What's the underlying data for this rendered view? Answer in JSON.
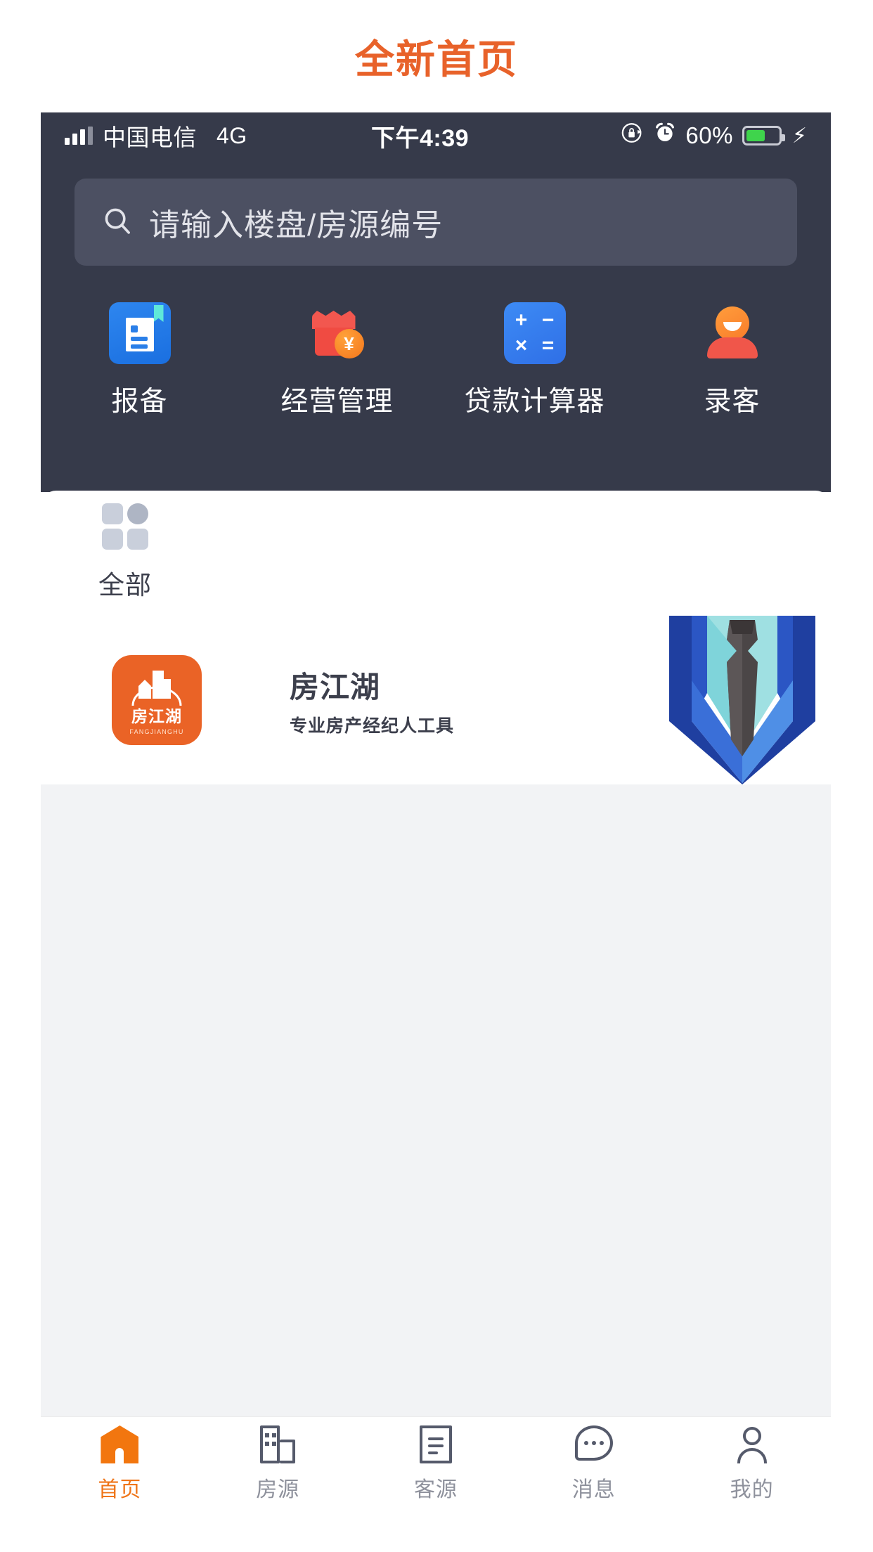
{
  "page": {
    "title": "全新首页",
    "title_color": "#e8622a"
  },
  "status_bar": {
    "carrier": "中国电信",
    "network": "4G",
    "time": "下午4:39",
    "battery_percent": "60%",
    "battery_level": 60,
    "battery_color": "#3fd44c",
    "icons": [
      "signal-bars-icon",
      "rotation-lock-icon",
      "alarm-clock-icon",
      "battery-icon",
      "charging-bolt-icon"
    ]
  },
  "search": {
    "placeholder": "请输入楼盘/房源编号",
    "icon": "search-icon"
  },
  "quick_actions": [
    {
      "label": "报备",
      "icon": "report-document-icon",
      "color": "#2a7fe8"
    },
    {
      "label": "经营管理",
      "icon": "shop-yuan-icon",
      "color": "#f04b42"
    },
    {
      "label": "贷款计算器",
      "icon": "calculator-icon",
      "color": "#3d8bf5"
    },
    {
      "label": "录客",
      "icon": "person-record-icon",
      "color": "#f97c2a"
    }
  ],
  "calculator_keys": [
    "+",
    "−",
    "×",
    "="
  ],
  "categories": [
    {
      "label": "全部",
      "icon": "grid-all-icon"
    }
  ],
  "app_list": [
    {
      "name": "房江湖",
      "description": "专业房产经纪人工具",
      "logo_text": "房江湖",
      "logo_pinyin": "FANGJIANGHU",
      "logo_color": "#ea6326",
      "art": "suit-tie-illustration"
    }
  ],
  "tabs": [
    {
      "label": "首页",
      "icon": "home-icon",
      "active": true
    },
    {
      "label": "房源",
      "icon": "buildings-icon",
      "active": false
    },
    {
      "label": "客源",
      "icon": "document-lines-icon",
      "active": false
    },
    {
      "label": "消息",
      "icon": "chat-bubble-icon",
      "active": false
    },
    {
      "label": "我的",
      "icon": "person-icon",
      "active": false
    }
  ],
  "colors": {
    "header_dark": "#363a4a",
    "search_field": "#4c5062",
    "gray_area": "#f2f3f5",
    "accent_orange": "#ef7518",
    "tab_inactive": "#8e919c"
  }
}
